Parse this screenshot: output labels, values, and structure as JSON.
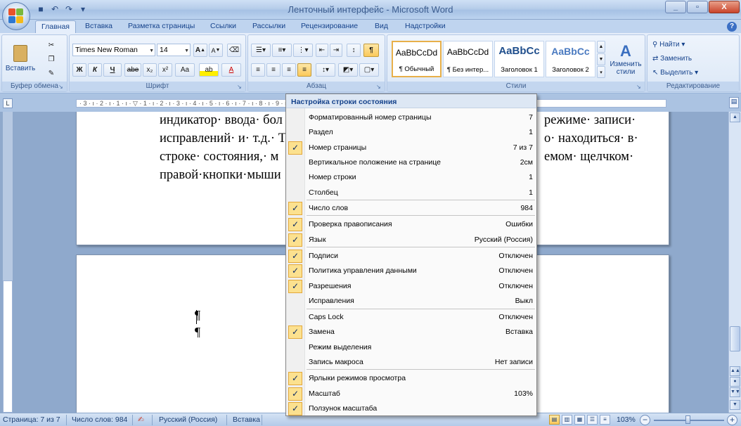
{
  "window": {
    "title": "Ленточный интерфейс - Microsoft Word",
    "minimize": "_",
    "maximize": "▫",
    "close": "X"
  },
  "tabs": [
    "Главная",
    "Вставка",
    "Разметка страницы",
    "Ссылки",
    "Рассылки",
    "Рецензирование",
    "Вид",
    "Надстройки"
  ],
  "ribbon": {
    "clipboard": {
      "paste": "Вставить",
      "label": "Буфер обмена"
    },
    "font": {
      "family": "Times New Roman",
      "size": "14",
      "label": "Шрифт",
      "bold": "Ж",
      "italic": "К",
      "underline": "Ч",
      "strike": "abe",
      "subscript": "x₂",
      "superscript": "x²",
      "case": "Aa",
      "grow": "A",
      "shrink": "A",
      "highlight": "ab",
      "color": "A"
    },
    "paragraph": {
      "label": "Абзац",
      "pilcrow": "¶"
    },
    "styles": {
      "label": "Стили",
      "items": [
        {
          "sample": "AaBbCcDd",
          "name": "¶ Обычный"
        },
        {
          "sample": "AaBbCcDd",
          "name": "¶ Без интер..."
        },
        {
          "sample": "AaBbCc",
          "name": "Заголовок 1"
        },
        {
          "sample": "AaBbCc",
          "name": "Заголовок 2"
        }
      ],
      "change": "Изменить стили"
    },
    "editing": {
      "label": "Редактирование",
      "find": "Найти",
      "replace": "Заменить",
      "select": "Выделить"
    }
  },
  "ruler": {
    "text": "· 3 · ı · 2 · ı · 1 · ı · ▽ · 1 · ı · 2 · ı · 3 · ı · 4 · ı · 5 · ı · 6 · ı · 7 · ı · 8 · ı · 9 · ı · 10 · ı · 11 · ı · 12 · ı · 13 · ı · 14 · ı · 15 · ı · 16 · △ 17 · ı ·",
    "corner": "L"
  },
  "document": {
    "lines": [
      "индикатор· ввода· бол",
      "исправлений· и· т.д.· Т",
      "строке· состояния,· м",
      "правой·кнопки·мыши"
    ],
    "lines_right": [
      "режиме· записи·",
      "о· находиться· в·",
      "емом· щелчком·"
    ],
    "marks": [
      "¶",
      "¶"
    ]
  },
  "context_menu": {
    "title": "Настройка строки состояния",
    "check_glyph": "✓",
    "items": [
      {
        "label": "Форматированный номер страницы",
        "value": "7",
        "checked": false
      },
      {
        "label": "Раздел",
        "value": "1",
        "checked": false
      },
      {
        "label": "Номер страницы",
        "value": "7 из 7",
        "checked": true
      },
      {
        "label": "Вертикальное положение на странице",
        "value": "2см",
        "checked": false
      },
      {
        "label": "Номер строки",
        "value": "1",
        "checked": false
      },
      {
        "label": "Столбец",
        "value": "1",
        "checked": false
      },
      {
        "label": "Число слов",
        "value": "984",
        "checked": true
      },
      {
        "label": "Проверка правописания",
        "value": "Ошибки",
        "checked": true
      },
      {
        "label": "Язык",
        "value": "Русский (Россия)",
        "checked": true
      },
      {
        "label": "Подписи",
        "value": "Отключен",
        "checked": true
      },
      {
        "label": "Политика управления данными",
        "value": "Отключен",
        "checked": true
      },
      {
        "label": "Разрешения",
        "value": "Отключен",
        "checked": true
      },
      {
        "label": "Исправления",
        "value": "Выкл",
        "checked": false
      },
      {
        "label": "Caps Lock",
        "value": "Отключен",
        "checked": false
      },
      {
        "label": "Замена",
        "value": "Вставка",
        "checked": true
      },
      {
        "label": "Режим выделения",
        "value": "",
        "checked": false
      },
      {
        "label": "Запись макроса",
        "value": "Нет записи",
        "checked": false
      },
      {
        "label": "Ярлыки режимов просмотра",
        "value": "",
        "checked": true
      },
      {
        "label": "Масштаб",
        "value": "103%",
        "checked": true
      },
      {
        "label": "Ползунок масштаба",
        "value": "",
        "checked": true
      }
    ]
  },
  "statusbar": {
    "page": "Страница: 7 из 7",
    "words": "Число слов: 984",
    "language": "Русский (Россия)",
    "mode": "Вставка",
    "zoom": "103%"
  }
}
